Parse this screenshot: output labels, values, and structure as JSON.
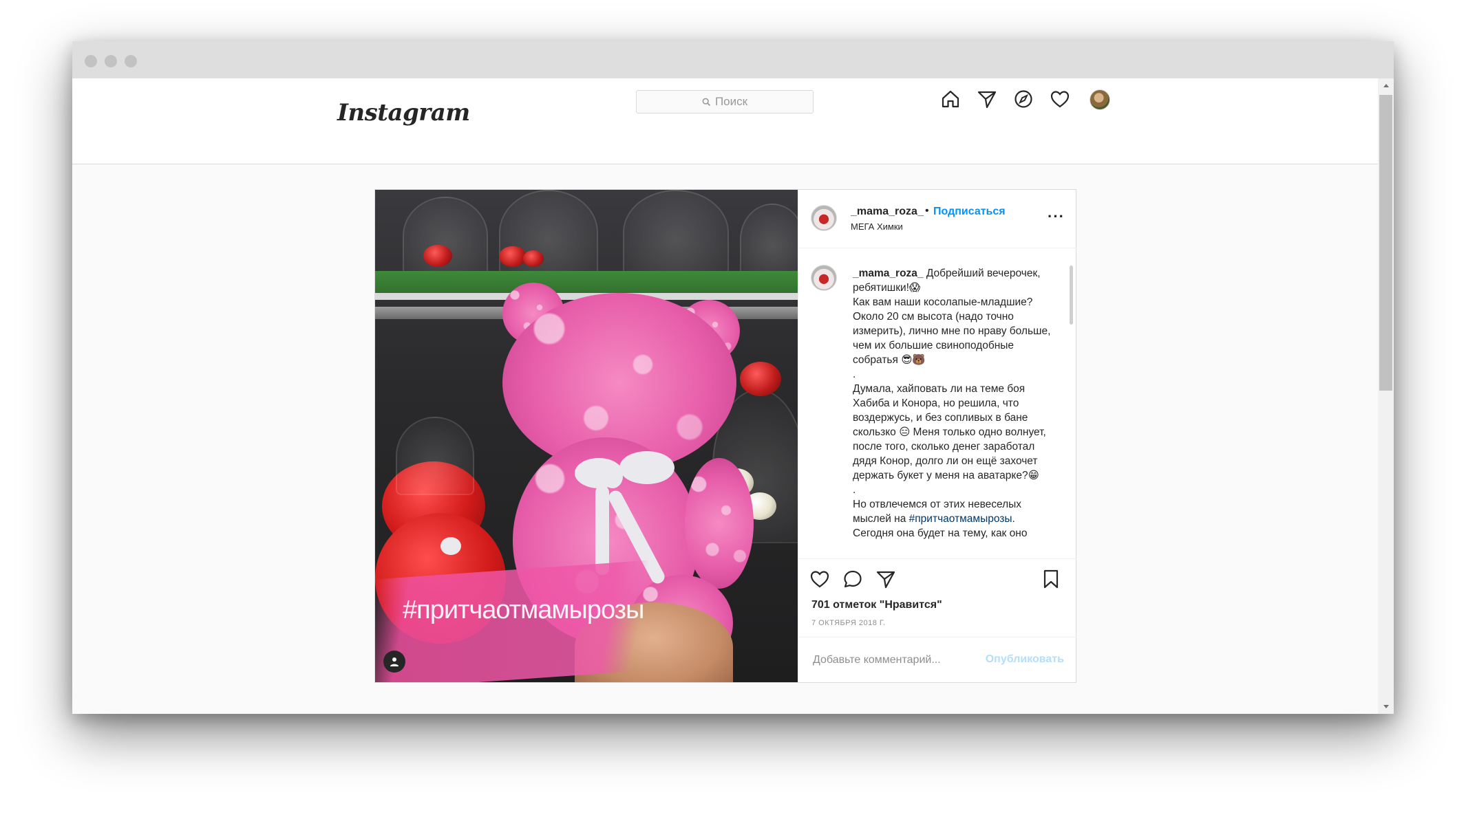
{
  "app": {
    "logo": "Instagram",
    "search": {
      "placeholder": "Поиск"
    },
    "nav": [
      "home-icon",
      "direct-icon",
      "explore-icon",
      "activity-icon",
      "profile-avatar"
    ]
  },
  "post": {
    "image_overlay_text": "#притчаотмамырозы",
    "header": {
      "username": "_mama_roza_",
      "separator": "•",
      "follow_label": "Подписаться",
      "location": "МЕГА Химки",
      "more": "···"
    },
    "caption": {
      "username": "_mama_roza_",
      "p1": "Добрейший вечерочек, ребятишки!😱",
      "p2": "Как вам наши косолапые-младшие? Около 20 см высота (надо точно измерить), лично мне по нраву больше, чем их большие свиноподобные собратья 😎🐻",
      "dot1": ".",
      "p3": "Думала, хайповать ли на теме боя Хабиба и Конора, но решила, что воздержусь, и без сопливых в бане скользко 😑 Меня только одно волнует, после того, сколько денег заработал дядя Конор, долго ли он ещё захочет держать букет у меня на аватарке?😁",
      "dot2": ".",
      "p4_prefix": "Но отвлечемся от этих невеселых мыслей на ",
      "p4_tag": "#притчаотмамырозы",
      "p4_suffix": ".",
      "p5": "Сегодня она будет на тему, как оно"
    },
    "likes": "701 отметок \"Нравится\"",
    "date": "7 ОКТЯБРЯ 2018 Г.",
    "comment": {
      "placeholder": "Добавьте комментарий...",
      "publish_label": "Опубликовать"
    }
  },
  "colors": {
    "link_blue": "#0095f6",
    "publish_disabled": "#b2dffc",
    "border": "#dbdbdb",
    "text": "#262626",
    "muted": "#8e8e8e"
  }
}
